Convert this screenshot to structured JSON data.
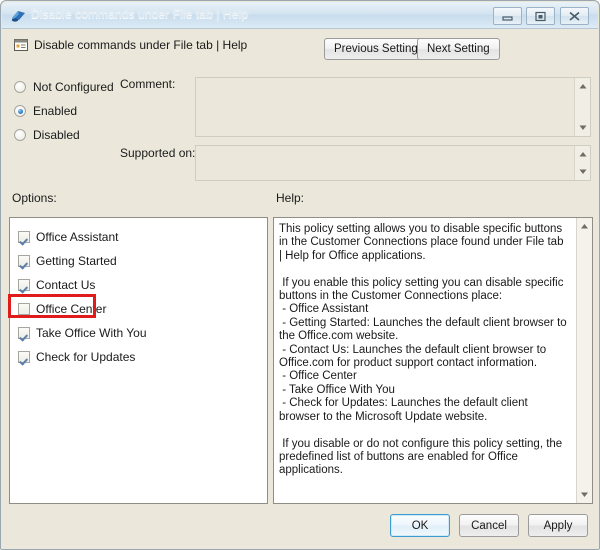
{
  "window": {
    "title": "Disable commands under File tab | Help",
    "icon": "policy-window-icon",
    "controls": {
      "minimize": "minimize-icon",
      "maximize": "maximize-icon",
      "close": "close-icon"
    }
  },
  "header": {
    "icon": "policy-setting-icon",
    "title": "Disable commands under File tab | Help",
    "previous_setting": "Previous Setting",
    "next_setting": "Next Setting"
  },
  "state": {
    "options": [
      "Not Configured",
      "Enabled",
      "Disabled"
    ],
    "selected": "Enabled"
  },
  "fields": {
    "comment_label": "Comment:",
    "comment_value": "",
    "supported_on_label": "Supported on:",
    "supported_on_value": ""
  },
  "panels": {
    "options_label": "Options:",
    "help_label": "Help:"
  },
  "checkboxes": [
    {
      "label": "Office Assistant",
      "checked": true
    },
    {
      "label": "Getting Started",
      "checked": true
    },
    {
      "label": "Contact Us",
      "checked": true
    },
    {
      "label": "Office Center",
      "checked": false
    },
    {
      "label": "Take Office With You",
      "checked": true
    },
    {
      "label": "Check for Updates",
      "checked": true
    }
  ],
  "help_text": "This policy setting allows you to disable specific buttons in the Customer Connections place found under File tab | Help for Office applications.\n\n If you enable this policy setting you can disable specific buttons in the Customer Connections place:\n - Office Assistant\n - Getting Started: Launches the default client browser to the Office.com website.\n - Contact Us: Launches the default client browser to Office.com for product support contact information.\n - Office Center\n - Take Office With You\n - Check for Updates: Launches the default client browser to the Microsoft Update website.\n\n If you disable or do not configure this policy setting, the predefined list of buttons are enabled for Office applications.",
  "footer": {
    "ok": "OK",
    "cancel": "Cancel",
    "apply": "Apply"
  },
  "colors": {
    "dialog_background": "#ebe8db",
    "highlight": "#e01b1b",
    "accent": "#2f7fc4",
    "panel_background": "#ffffff"
  }
}
